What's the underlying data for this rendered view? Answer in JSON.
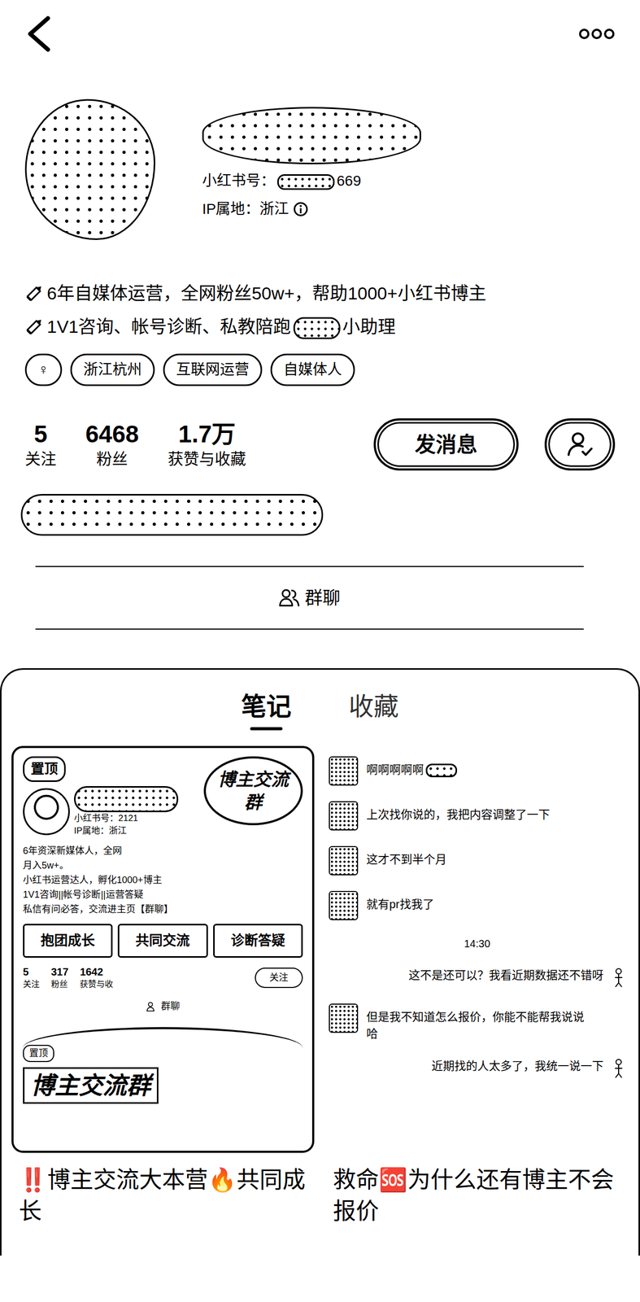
{
  "profile": {
    "id_parts": [
      "小红书号：",
      "669"
    ],
    "ip": "IP属地：浙江",
    "bio": [
      {
        "parts": [
          "6年自媒体运营，全网粉丝50w+，帮助1000+小红书博主"
        ]
      },
      {
        "parts": [
          "1V1咨询、帐号诊断、私教陪跑",
          "小助理"
        ]
      }
    ],
    "tags": [
      "♀",
      "浙江杭州",
      "互联网运营",
      "自媒体人"
    ],
    "stats": [
      {
        "value": "5",
        "label": "关注"
      },
      {
        "value": "6468",
        "label": "粉丝"
      },
      {
        "value": "1.7万",
        "label": "获赞与收藏"
      }
    ],
    "message_button": "发消息",
    "group_chat": "群聊"
  },
  "tabs": [
    {
      "label": "笔记",
      "selected": true
    },
    {
      "label": "收藏",
      "selected": false
    }
  ],
  "notes": [
    {
      "kind": "profile-shot",
      "title": "‼️博主交流大本营🔥共同成长",
      "cover": {
        "pin": "置顶",
        "id": "小红书号：2121",
        "ip": "IP属地：浙江",
        "bubble": "博主交流群",
        "bio": [
          "6年资深新媒体人，全网",
          "月入5w+。",
          "小红书运营达人，孵化1000+博主",
          "1V1咨询||帐号诊断||运营答疑",
          "私信有问必答，交流进主页【群聊】"
        ],
        "buttons": [
          "抱团成长",
          "共同交流",
          "诊断答疑"
        ],
        "stats": [
          {
            "value": "5",
            "label": "关注"
          },
          {
            "value": "317",
            "label": "粉丝"
          },
          {
            "value": "1642",
            "label": "获赞与收"
          }
        ],
        "follow": "关注",
        "group": "群聊",
        "footer_pin": "置顶",
        "footer": "博主交流群"
      }
    },
    {
      "kind": "chat-shot",
      "title": "救命🆘为什么还有博主不会报价",
      "messages": [
        {
          "kind": "received",
          "text": "啊啊啊啊啊",
          "redacted": true
        },
        {
          "kind": "received",
          "text": "上次找你说的，我把内容调整了一下",
          "redacted": false
        },
        {
          "kind": "received",
          "text": "这才不到半个月",
          "redacted": false
        },
        {
          "kind": "received",
          "text": "就有pr找我了",
          "redacted": false
        },
        {
          "kind": "time",
          "text": "14:30",
          "redacted": false
        },
        {
          "kind": "sent",
          "text": "这不是还可以？我看近期数据还不错呀",
          "redacted": false
        },
        {
          "kind": "received",
          "text": "但是我不知道怎么报价，你能不能帮我说说哈",
          "redacted": false
        },
        {
          "kind": "sent",
          "text": "近期找的人太多了，我统一说一下",
          "redacted": false
        }
      ]
    }
  ]
}
